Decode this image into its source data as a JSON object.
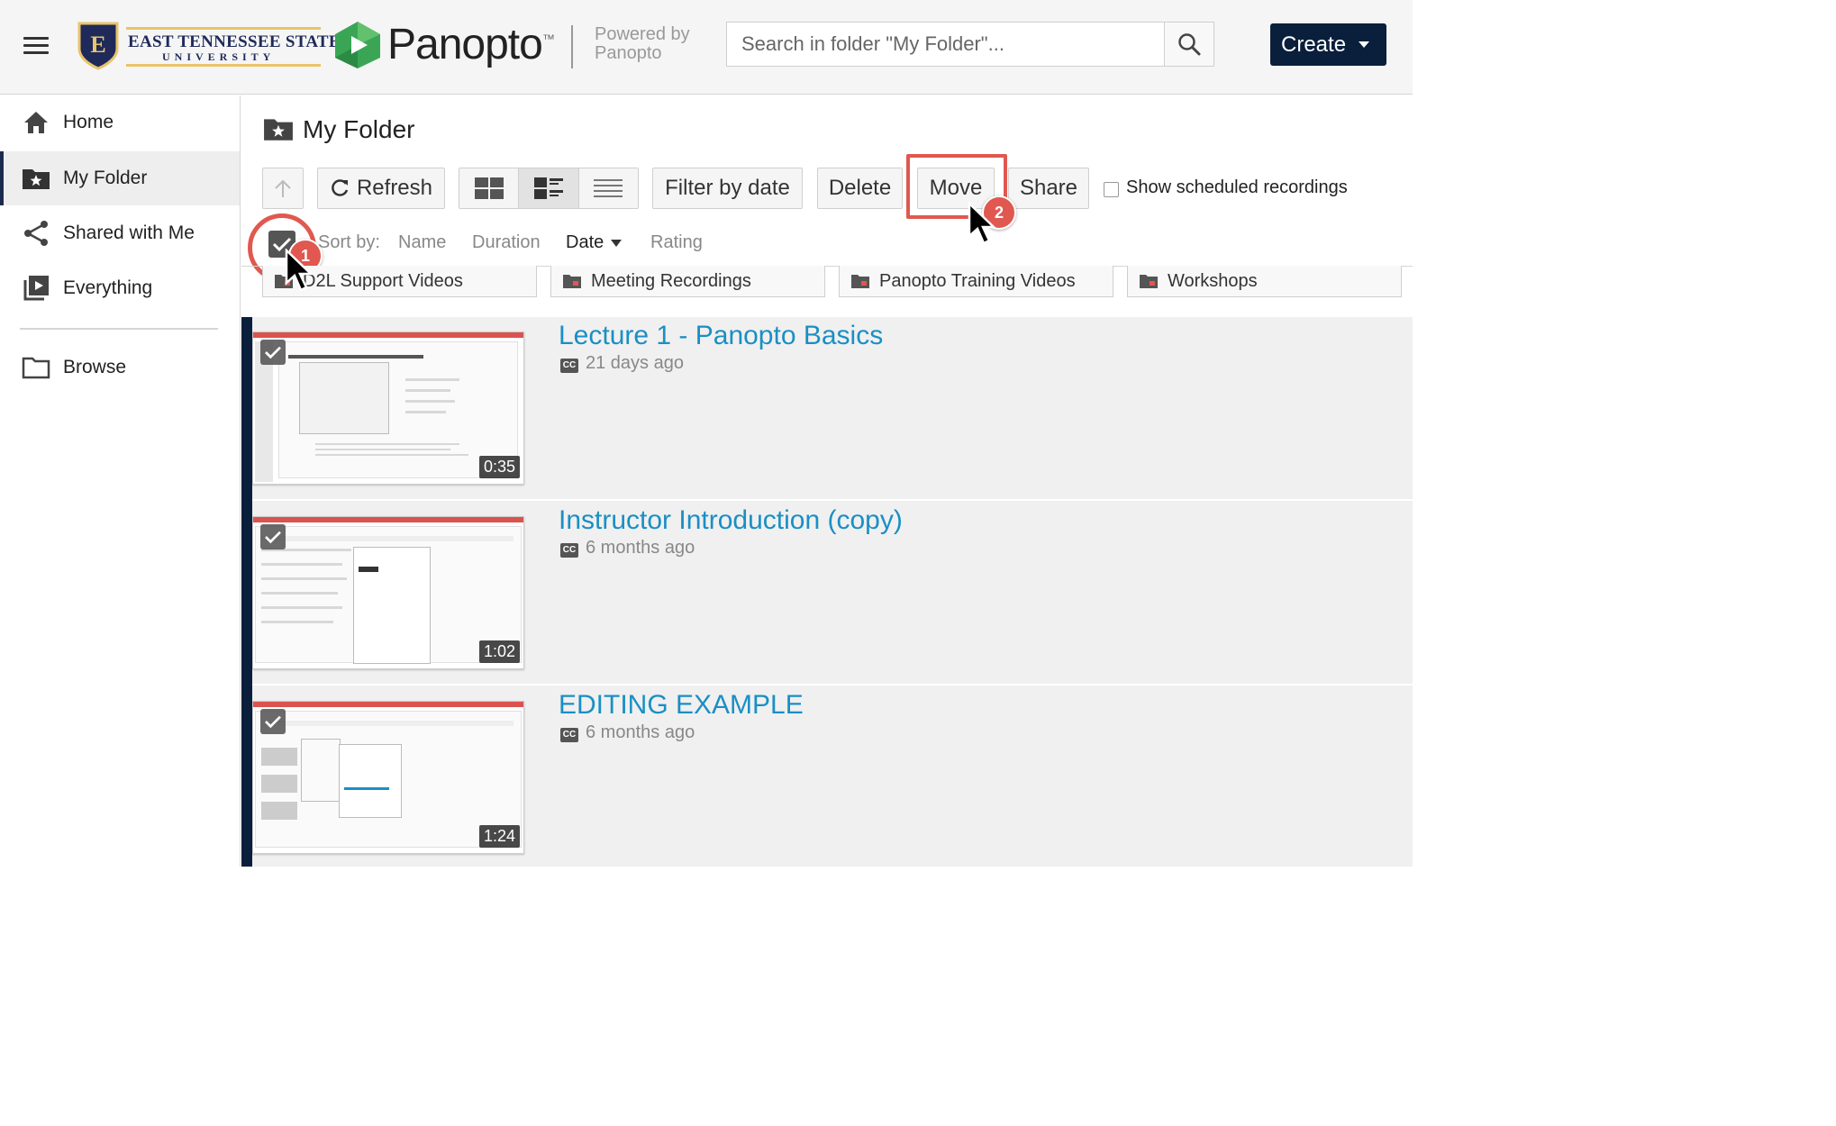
{
  "header": {
    "brand": {
      "etsu_line1": "EAST TENNESSEE STATE",
      "etsu_line2": "UNIVERSITY",
      "etsu_shield_letter": "E",
      "panopto_word": "Panopto",
      "panopto_tm": "™",
      "powered_by_line1": "Powered by",
      "powered_by_line2": "Panopto"
    },
    "search": {
      "placeholder": "Search in folder \"My Folder\"..."
    },
    "create_label": "Create"
  },
  "sidebar": {
    "items": [
      {
        "label": "Home",
        "icon": "home-icon",
        "active": false
      },
      {
        "label": "My Folder",
        "icon": "starred-folder-icon",
        "active": true
      },
      {
        "label": "Shared with Me",
        "icon": "share-icon",
        "active": false
      },
      {
        "label": "Everything",
        "icon": "playlist-icon",
        "active": false
      },
      {
        "label": "Browse",
        "icon": "folder-icon",
        "active": false
      }
    ]
  },
  "main": {
    "folder_title": "My Folder",
    "toolbar": {
      "refresh": "Refresh",
      "filter_by_date": "Filter by date",
      "delete": "Delete",
      "move": "Move",
      "share": "Share",
      "show_scheduled": "Show scheduled recordings"
    },
    "sort": {
      "label": "Sort by:",
      "options": [
        "Name",
        "Duration",
        "Date",
        "Rating"
      ],
      "active": "Date"
    },
    "subfolders": [
      "D2L Support Videos",
      "Meeting Recordings",
      "Panopto Training Videos",
      "Workshops"
    ],
    "sessions": [
      {
        "title": "Lecture 1 - Panopto Basics",
        "meta": "21 days ago",
        "duration": "0:35",
        "cc": "CC"
      },
      {
        "title": "Instructor Introduction (copy)",
        "meta": "6 months ago",
        "duration": "1:02",
        "cc": "CC"
      },
      {
        "title": "EDITING EXAMPLE",
        "meta": "6 months ago",
        "duration": "1:24",
        "cc": "CC"
      }
    ]
  },
  "annotations": {
    "step1": "1",
    "step2": "2"
  },
  "colors": {
    "accent_navy": "#0a1f3c",
    "link_blue": "#1a8fc4",
    "annotation_red": "#e0584f",
    "etsu_gold": "#e9c46a",
    "panopto_green": "#3aa655"
  }
}
